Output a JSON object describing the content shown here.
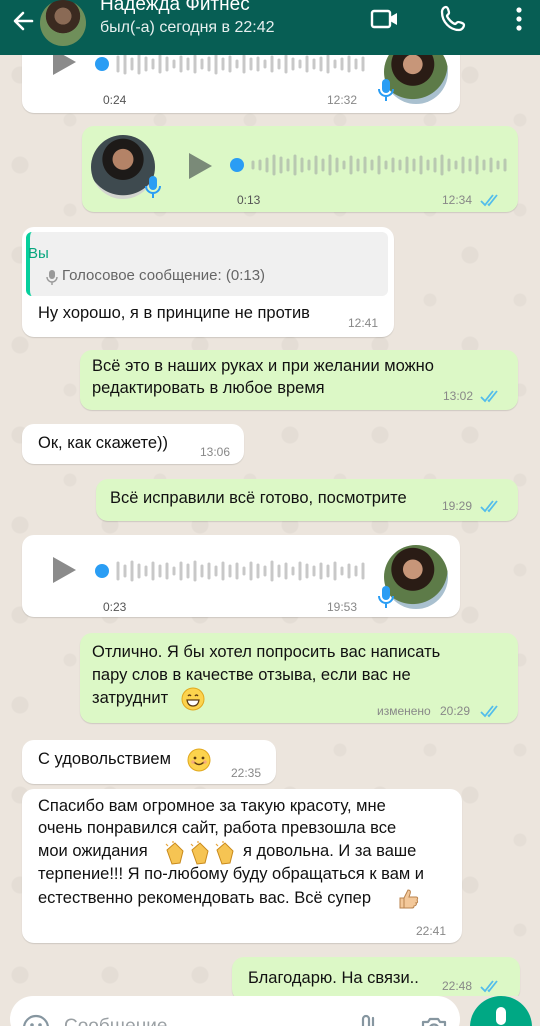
{
  "header": {
    "contact_name": "Надежда Фитнес",
    "last_seen": "был(-а) сегодня в 22:42",
    "icons": [
      "back-arrow-icon",
      "video-call-icon",
      "phone-icon"
    ],
    "color": "#075e54"
  },
  "messages": [
    {
      "id": "m1",
      "type": "voice",
      "direction": "in",
      "duration": "0:24",
      "time": "12:32"
    },
    {
      "id": "m2",
      "type": "voice",
      "direction": "out",
      "duration": "0:13",
      "time": "12:34",
      "read": true
    },
    {
      "id": "m3",
      "type": "text",
      "direction": "in",
      "quote_author": "Вы",
      "quote_text": "Голосовое сообщение: (0:13)",
      "text": "Ну хорошо, я в принципе не против",
      "time": "12:41"
    },
    {
      "id": "m4",
      "type": "text",
      "direction": "out",
      "lines": [
        "Всё это в наших руках и при желании можно",
        "редактировать в любое время"
      ],
      "time": "13:02",
      "read": true
    },
    {
      "id": "m5",
      "type": "text",
      "direction": "in",
      "text": "Ок, как скажете))",
      "time": "13:06"
    },
    {
      "id": "m6",
      "type": "text",
      "direction": "out",
      "text": "Всё исправили всё готово, посмотрите",
      "time": "19:29",
      "read": true
    },
    {
      "id": "m7",
      "type": "voice",
      "direction": "in",
      "duration": "0:23",
      "time": "19:53"
    },
    {
      "id": "m8",
      "type": "text",
      "direction": "out",
      "lines": [
        "Отлично. Я бы хотел попросить вас написать",
        "пару слов в качестве отзыва, если вас не",
        "затруднит"
      ],
      "edited_label": "изменено",
      "time": "20:29",
      "read": true
    },
    {
      "id": "m9",
      "type": "text",
      "direction": "in",
      "text": "С удовольствием",
      "time": "22:35"
    },
    {
      "id": "m10",
      "type": "text",
      "direction": "in",
      "lines": [
        "Спасибо вам огромное за такую красоту, мне",
        "очень понравился сайт, работа превзошла все",
        "мои ожидания",
        "я довольна. И  за ваше",
        "терпение!!! Я по-любому буду обращаться к вам и",
        "естественно рекомендовать вас. Всё супер"
      ],
      "time": "22:41"
    },
    {
      "id": "m11",
      "type": "text",
      "direction": "out",
      "text": "Благодарю. На связи..",
      "time": "22:48",
      "read": true
    }
  ],
  "input": {
    "placeholder": "Сообщение"
  },
  "colors": {
    "incoming": "#ffffff",
    "outgoing": "#dcf8c6",
    "read_ticks": "#53bdeb",
    "accent": "#00a884"
  }
}
